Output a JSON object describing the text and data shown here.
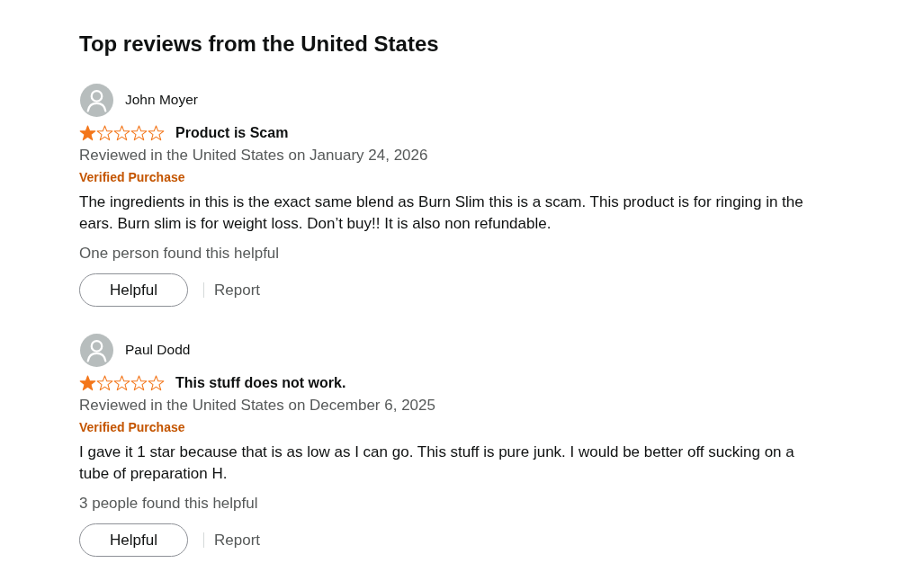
{
  "heading": "Top reviews from the United States",
  "reviews": [
    {
      "author": "John Moyer",
      "stars": 1,
      "title": "Product is Scam",
      "date_line": "Reviewed in the United States on January 24, 2026",
      "badge": "Verified Purchase",
      "body": "The ingredients in this is the exact same blend as Burn Slim this is a scam. This product is for ringing in the ears. Burn slim is for weight loss. Don’t buy!! It is also non refundable.",
      "helpful_count": "One person found this helpful",
      "helpful_button": "Helpful",
      "report_link": "Report"
    },
    {
      "author": "Paul Dodd",
      "stars": 1,
      "title": "This stuff does not work.",
      "date_line": "Reviewed in the United States on December 6, 2025",
      "badge": "Verified Purchase",
      "body": "I gave it 1 star because that is as low as I can go. This stuff is pure junk. I would be better off sucking on a tube of preparation H.",
      "helpful_count": "3 people found this helpful",
      "helpful_button": "Helpful",
      "report_link": "Report"
    }
  ]
}
